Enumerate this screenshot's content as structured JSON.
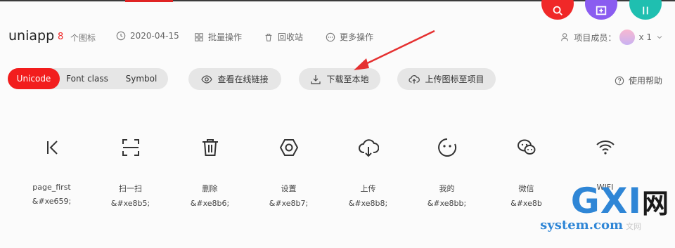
{
  "header": {
    "project": "uniapp",
    "icon_count": "8",
    "icon_count_label": "个图标",
    "date": "2020-04-15",
    "batch": "批量操作",
    "recycle": "回收站",
    "more": "更多操作",
    "members_label": "项目成员：",
    "members_count": "x 1"
  },
  "tabs": [
    "Unicode",
    "Font class",
    "Symbol"
  ],
  "actions": {
    "view_online": "查看在线链接",
    "download": "下载至本地",
    "upload": "上传图标至项目",
    "help": "使用帮助"
  },
  "icons": [
    {
      "name": "page_first",
      "code": "&#xe659;",
      "icon": "page-first-icon"
    },
    {
      "name": "扫一扫",
      "code": "&#xe8b5;",
      "icon": "scan-icon"
    },
    {
      "name": "删除",
      "code": "&#xe8b6;",
      "icon": "trash-icon"
    },
    {
      "name": "设置",
      "code": "&#xe8b7;",
      "icon": "settings-icon"
    },
    {
      "name": "上传",
      "code": "&#xe8b8;",
      "icon": "cloud-upload-icon"
    },
    {
      "name": "我的",
      "code": "&#xe8bb;",
      "icon": "smile-icon"
    },
    {
      "name": "微信",
      "code": "&#xe8b",
      "icon": "wechat-icon"
    },
    {
      "name": "WIFI",
      "code": "",
      "icon": "wifi-icon"
    }
  ],
  "watermark": {
    "logo": "GXI",
    "logo_char": "网",
    "domain": "system.com",
    "tail": "文网"
  },
  "colors": {
    "accent": "#f21d1d",
    "pill": "#e6e6e6"
  }
}
